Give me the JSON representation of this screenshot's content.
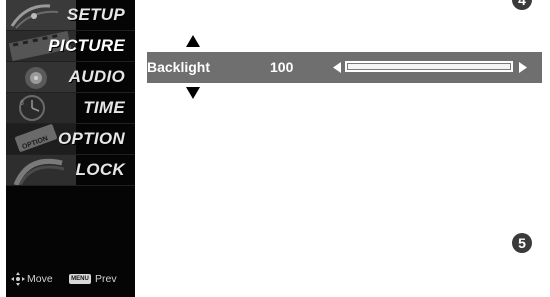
{
  "menu": {
    "items": [
      {
        "label": "SETUP",
        "icon": "satellite-dish-icon",
        "tint": "#8a8a8a"
      },
      {
        "label": "PICTURE",
        "icon": "film-strip-icon",
        "tint": "#6c6c6c"
      },
      {
        "label": "AUDIO",
        "icon": "speaker-icon",
        "tint": "#7a7a7a"
      },
      {
        "label": "TIME",
        "icon": "clock-icon",
        "tint": "#5e5e5e"
      },
      {
        "label": "OPTION",
        "icon": "option-tag-icon",
        "tint": "#4a4a4a"
      },
      {
        "label": "LOCK",
        "icon": "padlock-icon",
        "tint": "#707070"
      }
    ],
    "active": "PICTURE",
    "footer": {
      "move_label": "Move",
      "menu_key": "MENU",
      "prev_label": "Prev"
    }
  },
  "control": {
    "label": "Backlight",
    "value": "100",
    "level_fraction": 1.0
  },
  "steps": {
    "top_right": "4",
    "bottom_right": "5"
  },
  "colors": {
    "panel_bg": "#050505",
    "bar_bg": "#6f6f6f",
    "text": "#ffffff",
    "badge": "#3a3a3a"
  }
}
